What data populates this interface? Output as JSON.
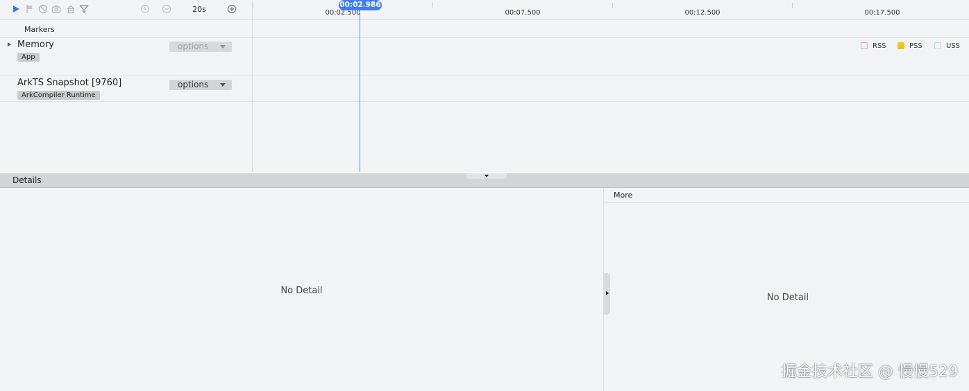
{
  "toolbar": {
    "icons": [
      "play-icon",
      "flag-icon",
      "stop-icon",
      "camera-icon",
      "home-icon",
      "filter-icon",
      "clock-icon",
      "zoom-out-icon",
      "zoom-in-icon"
    ],
    "zoom_value": "20s",
    "accent_color": "#2f7cf6"
  },
  "timeline": {
    "cursor_time": "00:02.986",
    "ticks": [
      "00:02.500",
      "00:07.500",
      "00:12.500",
      "00:17.500"
    ],
    "cursor_color": "#3e7cf0"
  },
  "lanes": {
    "markers_label": "Markers",
    "memory": {
      "title": "Memory",
      "tag": "App",
      "options_label": "options",
      "options_enabled": false
    },
    "arkts": {
      "title": "ArkTS Snapshot [9760]",
      "tag": "ArkCompiler Runtime",
      "options_label": "options",
      "options_enabled": true
    }
  },
  "legend": [
    {
      "label": "RSS",
      "color": "#e8a6ad",
      "filled": false
    },
    {
      "label": "PSS",
      "color": "#f2c21b",
      "filled": true
    },
    {
      "label": "USS",
      "color": "#b7e3de",
      "filled": false
    }
  ],
  "details": {
    "title": "Details",
    "empty_text": "No Detail"
  },
  "more": {
    "title": "More",
    "empty_text": "No Detail"
  },
  "watermark": "掘金技术社区 @ 慢慢529"
}
